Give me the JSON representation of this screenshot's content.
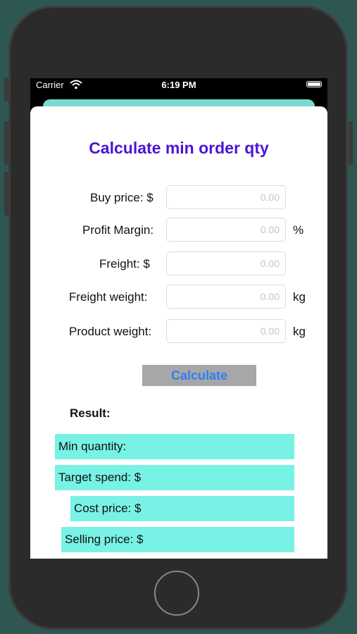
{
  "status": {
    "carrier": "Carrier",
    "time": "6:19 PM"
  },
  "screen": {
    "title": "Calculate min order qty",
    "fields": [
      {
        "label": "Buy price: $",
        "placeholder": "0.00",
        "unit": ""
      },
      {
        "label": "Profit Margin:",
        "placeholder": "0.00",
        "unit": "%"
      },
      {
        "label": "Freight: $",
        "placeholder": "0.00",
        "unit": ""
      },
      {
        "label": "Freight weight:",
        "placeholder": "0.00",
        "unit": "kg"
      },
      {
        "label": "Product weight:",
        "placeholder": "0.00",
        "unit": "kg"
      }
    ],
    "calculate_label": "Calculate",
    "result_title": "Result:",
    "results": [
      {
        "label": "Min quantity:"
      },
      {
        "label": "Target spend: $"
      },
      {
        "label": "Cost price: $"
      },
      {
        "label": "Selling price: $"
      }
    ]
  },
  "colors": {
    "title": "#4b15d8",
    "button_bg": "#a7a7a7",
    "button_text": "#2e7df6",
    "result_bg": "#79f2e6",
    "sheet_accent": "#7ad9d0"
  }
}
